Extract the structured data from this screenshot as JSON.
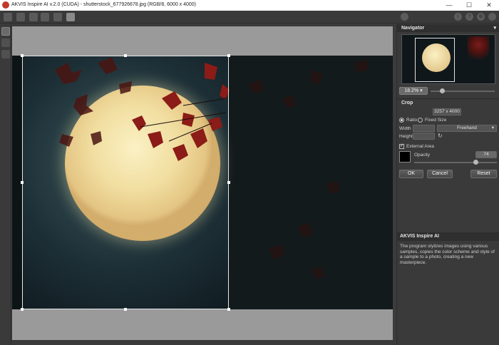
{
  "window": {
    "title": "AKVIS Inspire AI v.2.0 (CUDA) - shutterstock_677926678.jpg (RGB/8, 6000 x 4000)",
    "minimize": "—",
    "maximize": "☐",
    "close": "✕"
  },
  "toolbar": {
    "info_label": "i",
    "help_label": "?",
    "settings_label": "⚙"
  },
  "navigator": {
    "header": "Navigator",
    "zoom": "18.2%",
    "zoom_fraction": 0.18
  },
  "crop": {
    "header": "Crop",
    "size": "3257 x 4000",
    "ratio_label": "Ratio",
    "fixed_size_label": "Fixed Size",
    "width_label": "Width",
    "height_label": "Height",
    "preset": "Freehand",
    "external_area_label": "External Area",
    "external_area_checked": true,
    "opacity_label": "Opacity",
    "opacity_value": "74",
    "opacity_fraction": 0.74,
    "external_color": "#000000",
    "ok": "OK",
    "cancel": "Cancel",
    "reset": "Reset"
  },
  "about": {
    "header": "AKVIS Inspire AI",
    "text": "The program stylizes images using various samples, copies the color scheme and style of a sample to a photo, creating a new masterpiece."
  }
}
